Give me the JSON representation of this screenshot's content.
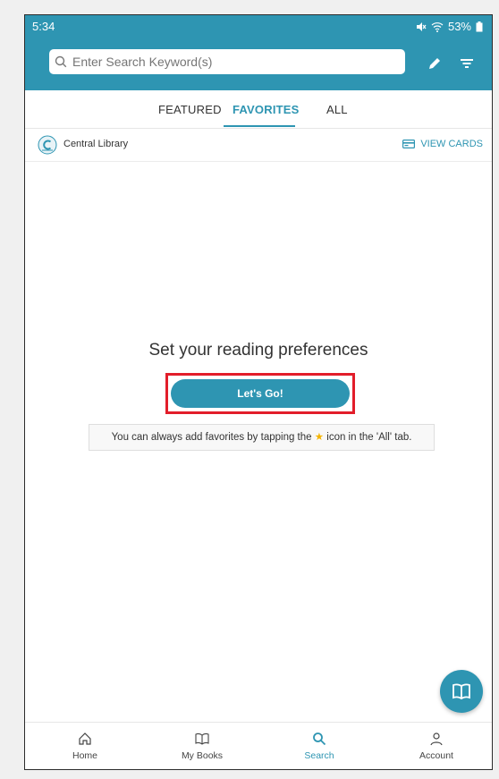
{
  "status": {
    "time": "5:34",
    "battery": "53%"
  },
  "search": {
    "placeholder": "Enter Search Keyword(s)"
  },
  "tabs": [
    {
      "label": "FEATURED"
    },
    {
      "label": "FAVORITES"
    },
    {
      "label": "ALL"
    }
  ],
  "library": {
    "name": "Central Library",
    "view_cards_label": "VIEW CARDS"
  },
  "main": {
    "heading": "Set your reading preferences",
    "button_label": "Let's Go!",
    "hint_before": "You can always add favorites by tapping the",
    "hint_after": "icon in the 'All' tab."
  },
  "bottom_nav": [
    {
      "label": "Home",
      "icon": "home-icon"
    },
    {
      "label": "My Books",
      "icon": "book-icon"
    },
    {
      "label": "Search",
      "icon": "search-icon"
    },
    {
      "label": "Account",
      "icon": "account-icon"
    }
  ],
  "colors": {
    "accent": "#2e95b2",
    "highlight": "#e21d2a",
    "star": "#f4b400"
  }
}
